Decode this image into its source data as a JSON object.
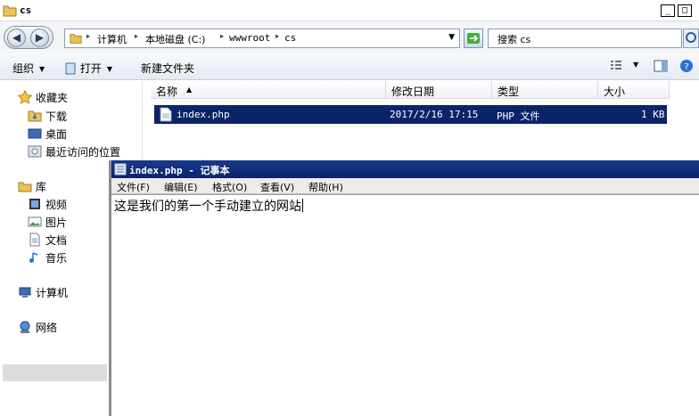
{
  "explorer": {
    "title": "cs",
    "window_buttons": {
      "minimize": "_",
      "maximize": "□"
    },
    "address": [
      "计算机",
      "本地磁盘 (C:)",
      "wwwroot",
      "cs"
    ],
    "search_placeholder": "搜索 cs",
    "toolbar": {
      "organize": "组织",
      "open": "打开",
      "new_folder": "新建文件夹"
    },
    "nav": {
      "favorites": "收藏夹",
      "downloads": "下载",
      "desktop": "桌面",
      "recent": "最近访问的位置",
      "libraries": "库",
      "videos": "视频",
      "pictures": "图片",
      "documents": "文档",
      "music": "音乐",
      "computer": "计算机",
      "network": "网络"
    },
    "columns": [
      "名称",
      "修改日期",
      "类型",
      "大小"
    ],
    "files": [
      {
        "name": "index.php",
        "modified": "2017/2/16 17:15",
        "type": "PHP 文件",
        "size": "1 KB"
      }
    ]
  },
  "notepad": {
    "title": "index.php - 记事本",
    "menu": [
      "文件(F)",
      "编辑(E)",
      "格式(O)",
      "查看(V)",
      "帮助(H)"
    ],
    "content": "这是我们的第一个手动建立的网站"
  },
  "colors": {
    "selection": "#0a246a",
    "title_active": "#0a246a"
  }
}
